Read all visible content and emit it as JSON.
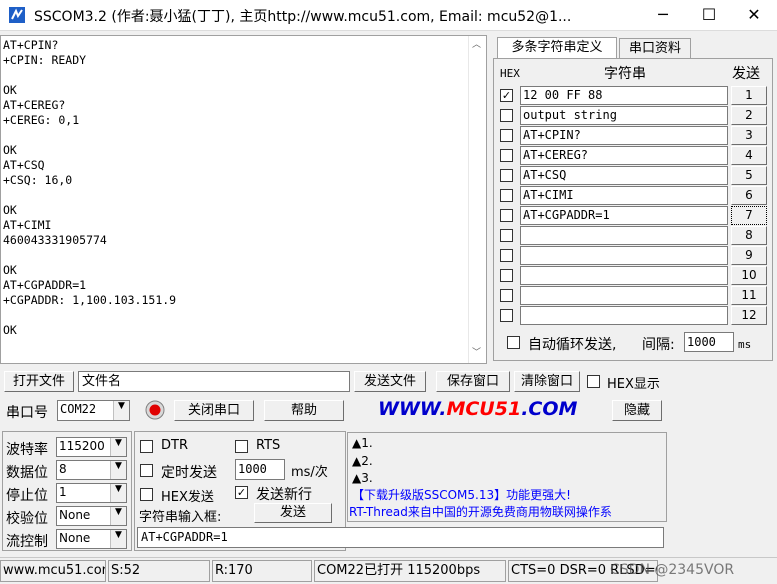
{
  "window": {
    "title": "SSCOM3.2 (作者:聂小猛(丁丁), 主页http://www.mcu51.com,  Email: mcu52@1...",
    "icon": "app-icon",
    "controls": [
      "─",
      "☐",
      "✕"
    ]
  },
  "receive": {
    "text": "AT+CPIN?\n+CPIN: READY\n\nOK\nAT+CEREG?\n+CEREG: 0,1\n\nOK\nAT+CSQ\n+CSQ: 16,0\n\nOK\nAT+CIMI\n460043331905774\n\nOK\nAT+CGPADDR=1\n+CGPADDR: 1,100.103.151.9\n\nOK"
  },
  "tabs": [
    {
      "label": "多条字符串定义"
    },
    {
      "label": "串口资料"
    }
  ],
  "multi": {
    "hex_header": "HEX",
    "string_header": "字符串",
    "send_header": "发送",
    "rows": [
      {
        "checked": true,
        "text": "12 00 FF 88",
        "num": "1"
      },
      {
        "checked": false,
        "text": "output string",
        "num": "2"
      },
      {
        "checked": false,
        "text": "AT+CPIN?",
        "num": "3"
      },
      {
        "checked": false,
        "text": "AT+CEREG?",
        "num": "4"
      },
      {
        "checked": false,
        "text": "AT+CSQ",
        "num": "5"
      },
      {
        "checked": false,
        "text": "AT+CIMI",
        "num": "6"
      },
      {
        "checked": false,
        "text": "AT+CGPADDR=1",
        "num": "7"
      },
      {
        "checked": false,
        "text": "",
        "num": "8"
      },
      {
        "checked": false,
        "text": "",
        "num": "9"
      },
      {
        "checked": false,
        "text": "",
        "num": "10"
      },
      {
        "checked": false,
        "text": "",
        "num": "11"
      },
      {
        "checked": false,
        "text": "",
        "num": "12"
      }
    ],
    "auto_loop_label": "自动循环发送,",
    "interval_label": "间隔:",
    "interval_value": "1000",
    "interval_unit": "ms"
  },
  "toolbar": {
    "open_file": "打开文件",
    "filename": "文件名",
    "send_file": "发送文件",
    "save_window": "保存窗口",
    "clear_window": "清除窗口",
    "hex_display": "HEX显示",
    "port_label": "串口号",
    "port_value": "COM22",
    "close_port": "关闭串口",
    "help": "帮助",
    "site_prefix": "WWW.",
    "site_brand": "MCU51",
    "site_suffix": ".COM",
    "hide": "隐藏"
  },
  "settings": {
    "baud_label": "波特率",
    "baud_value": "115200",
    "databits_label": "数据位",
    "databits_value": "8",
    "stopbits_label": "停止位",
    "stopbits_value": "1",
    "parity_label": "校验位",
    "parity_value": "None",
    "flow_label": "流控制",
    "flow_value": "None"
  },
  "options": {
    "dtr": "DTR",
    "rts": "RTS",
    "timed_send": "定时发送",
    "timed_value": "1000",
    "timed_unit": "ms/次",
    "hex_send": "HEX发送",
    "send_newline": "发送新行",
    "input_label": "字符串输入框:",
    "send_button": "发送",
    "input_value": "AT+CGPADDR=1"
  },
  "promo": {
    "lines": [
      "▲1.",
      "▲2.",
      "▲3."
    ],
    "ad1": "【下载升级版SSCOM5.13】功能更强大!",
    "ad2": "RT-Thread来自中国的开源免费商用物联网操作系"
  },
  "status": {
    "site": "www.mcu51.cor",
    "sent": "S:52",
    "received": "R:170",
    "port_state": "COM22已打开  115200bps",
    "lines": "CTS=0 DSR=0 RLSD=0",
    "watermark": "CSDN @2345VOR"
  },
  "colors": {
    "accent_blue": "#0000cc",
    "brand_red": "#ff0000",
    "promo_blue": "#0000ff"
  }
}
